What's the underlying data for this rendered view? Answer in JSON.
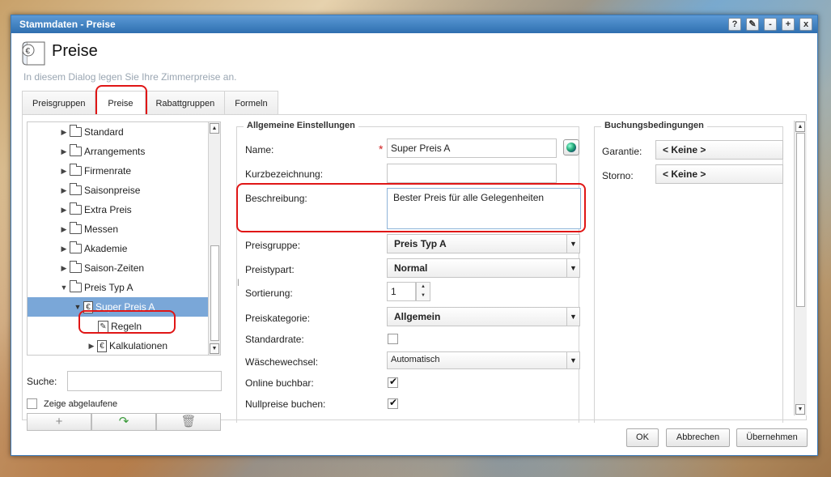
{
  "window": {
    "title": "Stammdaten - Preise",
    "buttons": [
      "?",
      "✎",
      "-",
      "+",
      "x"
    ]
  },
  "header": {
    "title": "Preise",
    "subtitle": "In diesem Dialog legen Sie Ihre Zimmerpreise an."
  },
  "tabs": [
    {
      "label": "Preisgruppen"
    },
    {
      "label": "Preise"
    },
    {
      "label": "Rabattgruppen"
    },
    {
      "label": "Formeln"
    }
  ],
  "tree": {
    "items": [
      {
        "label": "Standard",
        "icon": "folder-icon"
      },
      {
        "label": "Arrangements",
        "icon": "folder-icon"
      },
      {
        "label": "Firmenrate",
        "icon": "folder-icon"
      },
      {
        "label": "Saisonpreise",
        "icon": "folder-icon"
      },
      {
        "label": "Extra Preis",
        "icon": "folder-icon"
      },
      {
        "label": "Messen",
        "icon": "folder-icon"
      },
      {
        "label": "Akademie",
        "icon": "folder-icon"
      },
      {
        "label": "Saison-Zeiten",
        "icon": "folder-icon"
      },
      {
        "label": "Preis Typ A",
        "icon": "folder-icon"
      },
      {
        "label": "Super Preis A",
        "icon": "euro-document-icon"
      },
      {
        "label": "Regeln",
        "icon": "pencil-document-icon"
      },
      {
        "label": "Kalkulationen",
        "icon": "euro-document-icon"
      }
    ],
    "search_label": "Suche:",
    "search_value": "",
    "show_expired_label": "Zeige abgelaufene"
  },
  "general": {
    "legend": "Allgemeine Einstellungen",
    "name_label": "Name:",
    "name_value": "Super Preis A",
    "short_label": "Kurzbezeichnung:",
    "short_value": "",
    "desc_label": "Beschreibung:",
    "desc_value": "Bester Preis für alle Gelegenheiten",
    "group_label": "Preisgruppe:",
    "group_value": "Preis Typ A",
    "type_label": "Preistypart:",
    "type_value": "Normal",
    "sort_label": "Sortierung:",
    "sort_value": "1",
    "category_label": "Preiskategorie:",
    "category_value": "Allgemein",
    "standard_label": "Standardrate:",
    "laundry_label": "Wäschewechsel:",
    "laundry_value": "Automatisch",
    "online_label": "Online buchbar:",
    "zero_label": "Nullpreise buchen:"
  },
  "booking": {
    "legend": "Buchungsbedingungen",
    "guarantee_label": "Garantie:",
    "guarantee_value": "< Keine >",
    "cancel_label": "Storno:",
    "cancel_value": "< Keine >"
  },
  "footer": {
    "ok": "OK",
    "cancel": "Abbrechen",
    "apply": "Übernehmen"
  },
  "colors": {
    "title_bar": "#3a7cc0",
    "selection": "#7aa7d8",
    "highlight_ring": "#e01616"
  }
}
